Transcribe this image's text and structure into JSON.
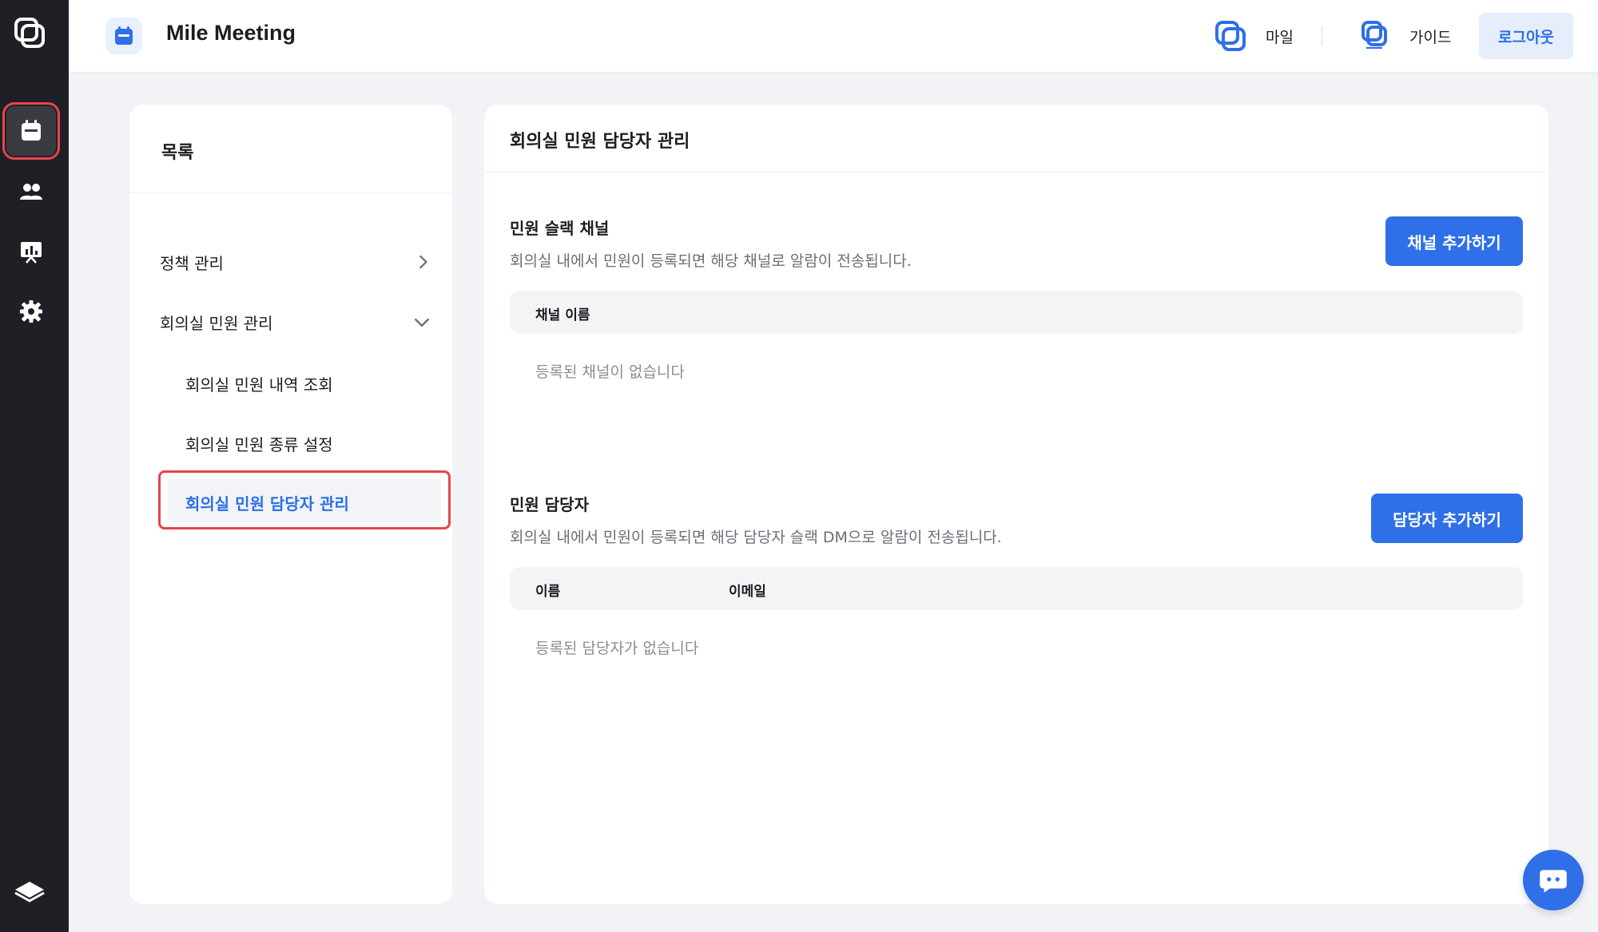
{
  "app": {
    "title": "Mile Meeting"
  },
  "header": {
    "mile_label": "마일",
    "guide_label": "가이드",
    "logout_label": "로그아웃"
  },
  "rail": {
    "items": [
      {
        "icon": "calendar-icon",
        "active": true
      },
      {
        "icon": "users-icon",
        "active": false
      },
      {
        "icon": "presentation-icon",
        "active": false
      },
      {
        "icon": "gear-icon",
        "active": false
      }
    ],
    "bottom_icon": "book-icon"
  },
  "sidebar": {
    "title": "목록",
    "items": [
      {
        "label": "정책 관리",
        "expanded": false
      },
      {
        "label": "회의실 민원 관리",
        "expanded": true
      }
    ],
    "subitems": [
      {
        "label": "회의실 민원 내역 조회"
      },
      {
        "label": "회의실 민원 종류 설정"
      },
      {
        "label": "회의실 민원 담당자 관리",
        "active": true
      }
    ]
  },
  "main": {
    "title": "회의실 민원 담당자 관리",
    "channel_section": {
      "title": "민원 슬랙 채널",
      "description": "회의실 내에서 민원이 등록되면 해당 채널로 알람이 전송됩니다.",
      "button_label": "채널 추가하기",
      "columns": [
        "채널 이름"
      ],
      "empty_text": "등록된 채널이 없습니다"
    },
    "manager_section": {
      "title": "민원 담당자",
      "description": "회의실 내에서 민원이 등록되면 해당 담당자 슬랙 DM으로 알람이 전송됩니다.",
      "button_label": "담당자 추가하기",
      "columns": [
        "이름",
        "이메일"
      ],
      "empty_text": "등록된 담당자가 없습니다"
    }
  },
  "colors": {
    "accent": "#2f6fe8",
    "highlight": "#e8444c",
    "rail_bg": "#1f2025"
  }
}
